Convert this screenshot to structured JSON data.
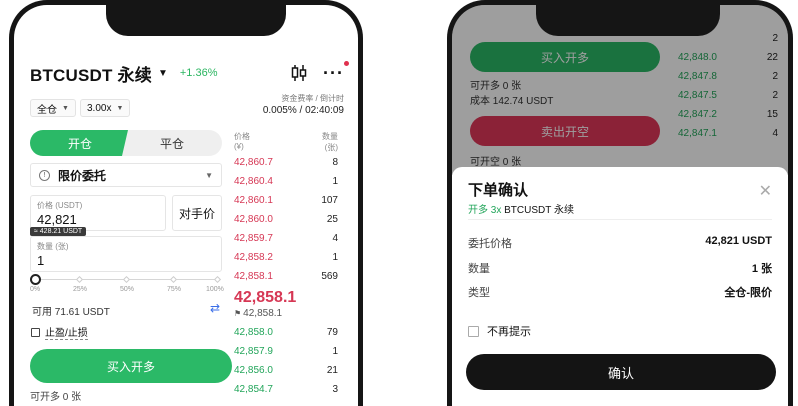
{
  "left": {
    "symbol": "BTCUSDT 永续",
    "change": "+1.36%",
    "margin_mode": "全仓",
    "leverage": "3.00x",
    "funding_label": "资金费率 / 倒计时",
    "funding_value": "0.005% / 02:40:09",
    "tab_open": "开仓",
    "tab_close": "平仓",
    "order_type": "限价委托",
    "price_label": "价格 (USDT)",
    "price_value": "42,821",
    "counterparty_button": "对手价",
    "usd_tip": "≈ 428.21 USDT",
    "qty_label": "数量 (张)",
    "qty_value": "1",
    "slider_ticks": [
      "0%",
      "25%",
      "50%",
      "75%",
      "100%"
    ],
    "slider_value_percent": 0,
    "available": "可用 71.61 USDT",
    "tpsl_label": "止盈/止损",
    "buy_button": "买入开多",
    "can_open": "可开多 0 张",
    "orderbook": {
      "price_header": "价格",
      "price_unit": "(¥)",
      "qty_header": "数量",
      "qty_unit": "(张)",
      "asks": [
        {
          "price": "42,860.7",
          "qty": "8"
        },
        {
          "price": "42,860.4",
          "qty": "1"
        },
        {
          "price": "42,860.1",
          "qty": "107"
        },
        {
          "price": "42,860.0",
          "qty": "25"
        },
        {
          "price": "42,859.7",
          "qty": "4"
        },
        {
          "price": "42,858.2",
          "qty": "1"
        },
        {
          "price": "42,858.1",
          "qty": "569"
        }
      ],
      "last_price": "42,858.1",
      "mark_price": "42,858.1",
      "bids": [
        {
          "price": "42,858.0",
          "qty": "79"
        },
        {
          "price": "42,857.9",
          "qty": "1"
        },
        {
          "price": "42,856.0",
          "qty": "21"
        },
        {
          "price": "42,854.7",
          "qty": "3"
        }
      ]
    }
  },
  "right": {
    "buy_button": "买入开多",
    "can_open_long": "可开多 0 张",
    "cost": "成本 142.74 USDT",
    "sell_button": "卖出开空",
    "can_open_short": "可开空 0 张",
    "orderbook": [
      {
        "price": "",
        "qty": "2"
      },
      {
        "price": "42,848.0",
        "qty": "22"
      },
      {
        "price": "42,847.8",
        "qty": "2"
      },
      {
        "price": "42,847.5",
        "qty": "2"
      },
      {
        "price": "42,847.2",
        "qty": "15"
      },
      {
        "price": "42,847.1",
        "qty": "4"
      }
    ],
    "dialog": {
      "title": "下单确认",
      "sub_prefix": "开多 3x",
      "sub_symbol": "BTCUSDT 永续",
      "rows": [
        {
          "key": "委托价格",
          "value": "42,821 USDT"
        },
        {
          "key": "数量",
          "value": "1 张"
        },
        {
          "key": "类型",
          "value": "全仓-限价"
        }
      ],
      "no_remind": "不再提示",
      "confirm": "确认"
    }
  },
  "colors": {
    "green": "#2bb967",
    "red": "#e0385a",
    "dark": "#141414"
  }
}
